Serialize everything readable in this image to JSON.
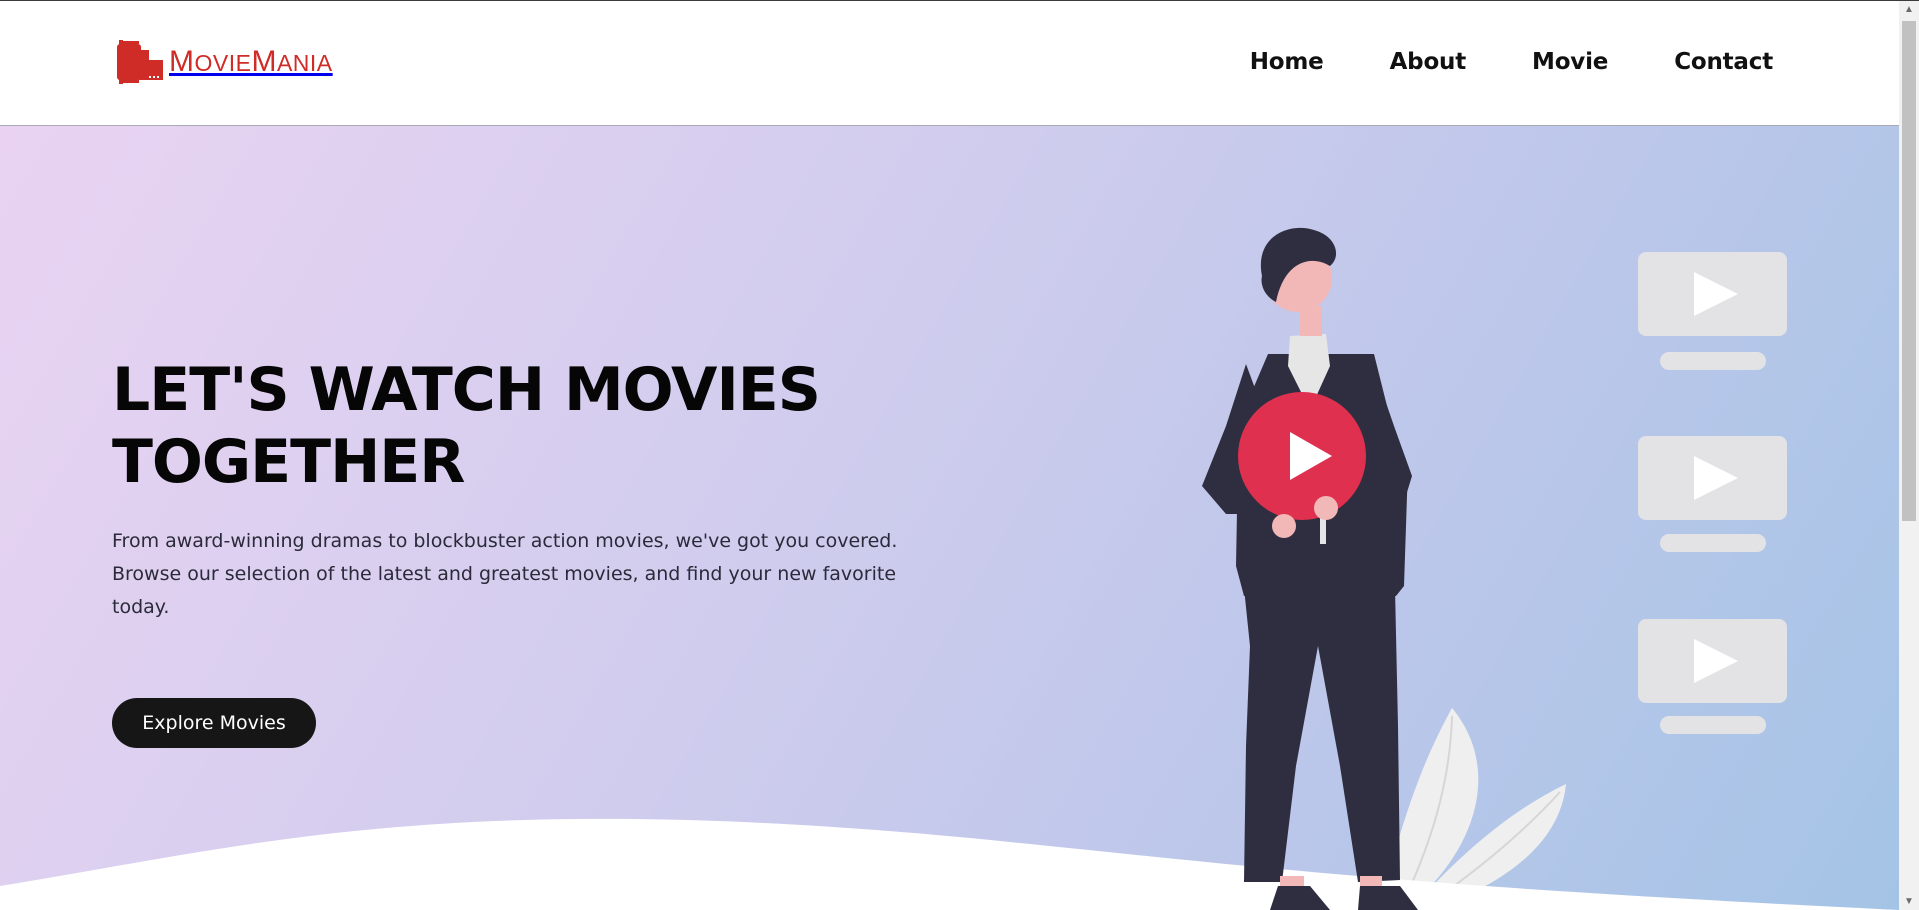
{
  "logo": {
    "text_first": "M",
    "text_rest": "OVIE",
    "text_second": "M",
    "text_rest2": "ANIA",
    "icon": "film-reel-icon",
    "color": "#cf2b27"
  },
  "nav": {
    "items": [
      {
        "label": "Home"
      },
      {
        "label": "About"
      },
      {
        "label": "Movie"
      },
      {
        "label": "Contact"
      }
    ]
  },
  "hero": {
    "headline_line1": "LET'S WATCH MOVIES",
    "headline_line2": "TOGETHER",
    "subtitle": "From award-winning dramas to blockbuster action movies, we've got you covered. Browse our selection of the latest and greatest movies, and find your new favorite today.",
    "cta_label": "Explore Movies"
  },
  "illustration": {
    "person": "person-holding-play-sign",
    "play_icon_color": "#e0304f",
    "thumbnails": 3
  },
  "colors": {
    "gradient_start": "#ead3f2",
    "gradient_end": "#a4c4e6",
    "accent": "#cf2b27",
    "button": "#161616"
  }
}
